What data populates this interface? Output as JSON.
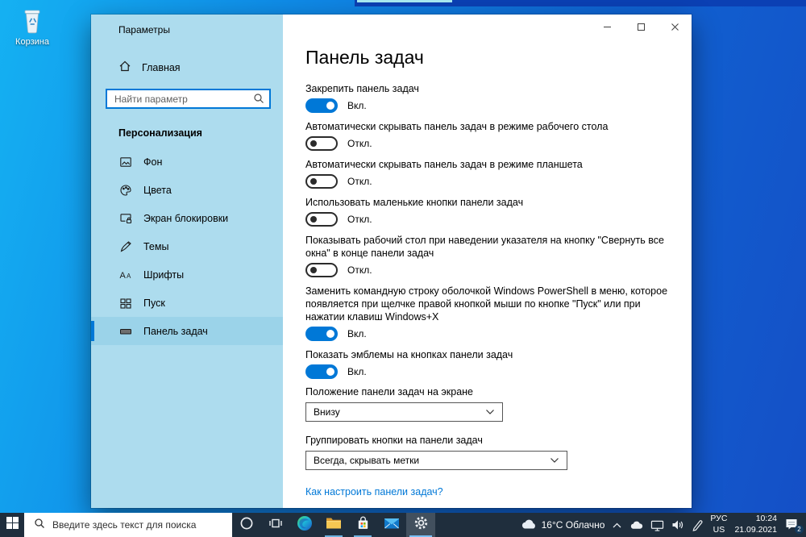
{
  "desktop": {
    "recycle_bin_label": "Корзина"
  },
  "window": {
    "title": "Параметры",
    "sidebar": {
      "home_label": "Главная",
      "search_placeholder": "Найти параметр",
      "section_title": "Персонализация",
      "items": [
        {
          "label": "Фон"
        },
        {
          "label": "Цвета"
        },
        {
          "label": "Экран блокировки"
        },
        {
          "label": "Темы"
        },
        {
          "label": "Шрифты"
        },
        {
          "label": "Пуск"
        },
        {
          "label": "Панель задач"
        }
      ]
    },
    "content": {
      "title": "Панель задач",
      "toggles": [
        {
          "label": "Закрепить панель задач",
          "state": "Вкл."
        },
        {
          "label": "Автоматически скрывать панель задач в режиме рабочего стола",
          "state": "Откл."
        },
        {
          "label": "Автоматически скрывать панель задач в режиме планшета",
          "state": "Откл."
        },
        {
          "label": "Использовать маленькие кнопки панели задач",
          "state": "Откл."
        },
        {
          "label": "Показывать рабочий стол при наведении указателя на кнопку \"Свернуть все окна\" в конце панели задач",
          "state": "Откл."
        },
        {
          "label": "Заменить командную строку оболочкой Windows PowerShell в меню, которое появляется при щелчке правой кнопкой мыши по кнопке \"Пуск\" или при нажатии клавиш Windows+X",
          "state": "Вкл."
        },
        {
          "label": "Показать эмблемы на кнопках панели задач",
          "state": "Вкл."
        }
      ],
      "dropdowns": [
        {
          "label": "Положение панели задач на экране",
          "value": "Внизу"
        },
        {
          "label": "Группировать кнопки на панели задач",
          "value": "Всегда, скрывать метки"
        }
      ],
      "link": "Как настроить панели задач?"
    }
  },
  "taskbar": {
    "search_placeholder": "Введите здесь текст для поиска",
    "tray": {
      "weather": "16°C Облачно",
      "lang_top": "РУС",
      "lang_bottom": "US",
      "time": "10:24",
      "date": "21.09.2021",
      "badge": "2"
    }
  },
  "colors": {
    "accent": "#0078d7",
    "sidebar_bg": "#addcee",
    "taskbar_bg": "#1f2e3d"
  }
}
